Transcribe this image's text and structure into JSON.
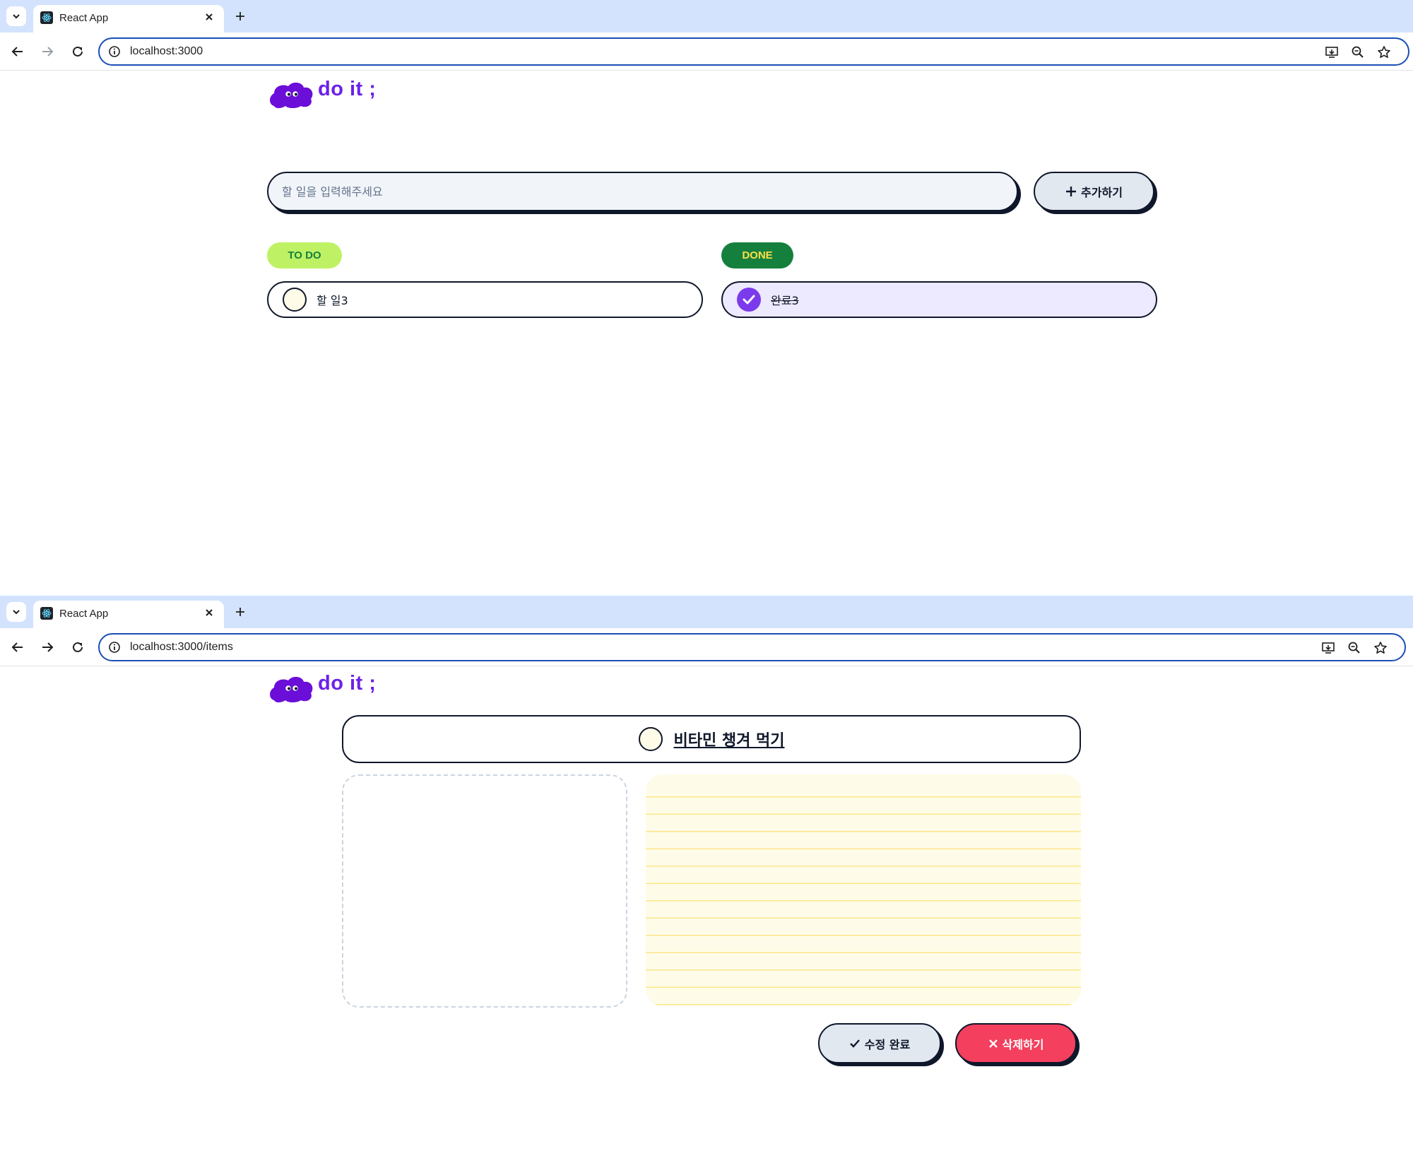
{
  "screen1": {
    "browser": {
      "tab_title": "React App",
      "url": "localhost:3000"
    },
    "logo": {
      "text": "do it ;"
    },
    "input": {
      "placeholder": "할 일을 입력해주세요",
      "value": ""
    },
    "add_button": {
      "label": "추가하기",
      "icon": "plus-icon"
    },
    "todo": {
      "badge": "TO DO",
      "items": [
        {
          "text": "할 일3",
          "done": false
        }
      ]
    },
    "done": {
      "badge": "DONE",
      "items": [
        {
          "text": "완료3",
          "done": true
        }
      ]
    }
  },
  "screen2": {
    "browser": {
      "tab_title": "React App",
      "url": "localhost:3000/items"
    },
    "logo": {
      "text": "do it ;"
    },
    "detail": {
      "title": "비타민 챙겨 먹기",
      "done": false,
      "memo": ""
    },
    "edit_button": {
      "label": "수정 완료",
      "icon": "check-icon"
    },
    "delete_button": {
      "label": "삭제하기",
      "icon": "x-icon"
    }
  },
  "colors": {
    "brand": "#6b21e8",
    "todo_badge_bg": "#bef264",
    "done_badge_bg": "#15803d",
    "done_item_bg": "#ede9fe",
    "delete": "#f43f5e",
    "memo_bg": "#fefce8"
  }
}
